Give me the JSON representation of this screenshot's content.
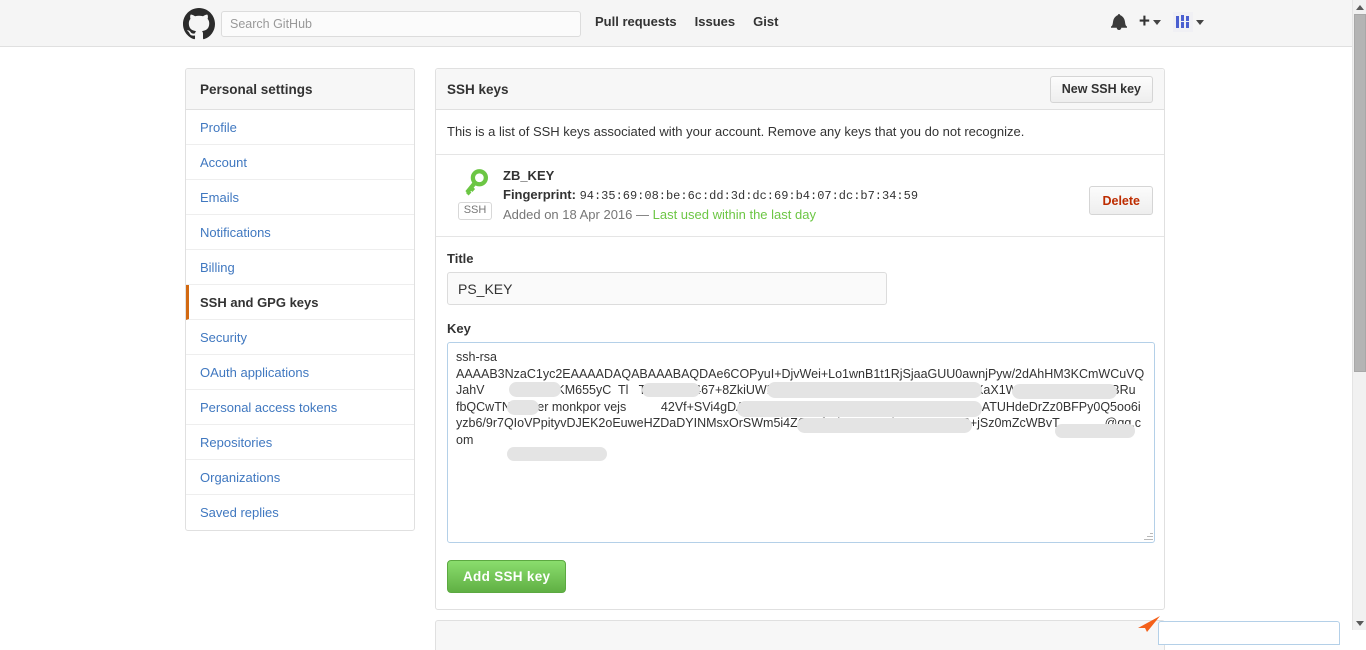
{
  "header": {
    "logo_icon": "github-octocat-logo",
    "search": {
      "placeholder": "Search GitHub",
      "value": ""
    },
    "nav": [
      {
        "label": "Pull requests"
      },
      {
        "label": "Issues"
      },
      {
        "label": "Gist"
      }
    ],
    "notifications_icon": "bell-icon",
    "create_new_label": "+",
    "avatar_icon": "user-avatar",
    "accent_blue": "#4078c0",
    "bar_background": "#f5f5f5"
  },
  "sidebar": {
    "heading": "Personal settings",
    "items": [
      {
        "label": "Profile",
        "active": false
      },
      {
        "label": "Account",
        "active": false
      },
      {
        "label": "Emails",
        "active": false
      },
      {
        "label": "Notifications",
        "active": false
      },
      {
        "label": "Billing",
        "active": false
      },
      {
        "label": "SSH and GPG keys",
        "active": true
      },
      {
        "label": "Security",
        "active": false
      },
      {
        "label": "OAuth applications",
        "active": false
      },
      {
        "label": "Personal access tokens",
        "active": false
      },
      {
        "label": "Repositories",
        "active": false
      },
      {
        "label": "Organizations",
        "active": false
      },
      {
        "label": "Saved replies",
        "active": false
      }
    ],
    "active_marker_color": "#d26911"
  },
  "main": {
    "panel_title": "SSH keys",
    "new_key_button": "New SSH key",
    "description": "This is a list of SSH keys associated with your account. Remove any keys that you do not recognize.",
    "existing_keys": [
      {
        "icon": "key-icon",
        "type_badge": "SSH",
        "title": "ZB_KEY",
        "fingerprint_label": "Fingerprint:",
        "fingerprint": "94:35:69:08:be:6c:dd:3d:dc:69:b4:07:dc:b7:34:59",
        "added_text": "Added on 18 Apr 2016 — ",
        "last_used_text": "Last used within the last day",
        "last_used_color": "#6cc644",
        "delete_button": "Delete",
        "delete_color": "#bd2c00"
      }
    ],
    "form": {
      "title_label": "Title",
      "title_value": "PS_KEY",
      "title_placeholder": "",
      "key_label": "Key",
      "key_value": "ssh-rsa\nAAAAB3NzaC1yc2EAAAADAQABAAABAQDAe6COPyuI+DjvWei+Lo1wnB1t1RjSjaaGUU0awnjPyw/2dAhHM3KCmWCuVQJahV       CNK+ZsKM655yC  Tl   TfFlxvlUG467+8ZkiUWPEJxV                      RGVOmasfCFZyXaX1W29d88BXEZ2cpsBRu   fbQCwTNbNtner monkpor vejs          42Vf+SVi4gDAgmzAvEsEP8zr        epFAEAiPz+RBrqG5+ATUHdeDrZz0BFPy0Q5oo6iyzb6/9r7QIoVPpityvDJEK2oEuweHZDaDYINMsxOrSWm5i4ZOu4fcsit6qy9I9H/wrPAHTYVq3+jSz0mZcWBvT             @qq.com",
      "key_placeholder": "",
      "submit_button": "Add SSH key",
      "submit_color": "#60b044"
    },
    "redactions": 7
  },
  "scrollbar": {
    "up_arrow_icon": "triangle-up-icon",
    "down_arrow_icon": "triangle-down-icon",
    "thumb_position": "top"
  },
  "cursor": {
    "icon": "mouse-pointer-arrow",
    "color": "#f4601a"
  }
}
